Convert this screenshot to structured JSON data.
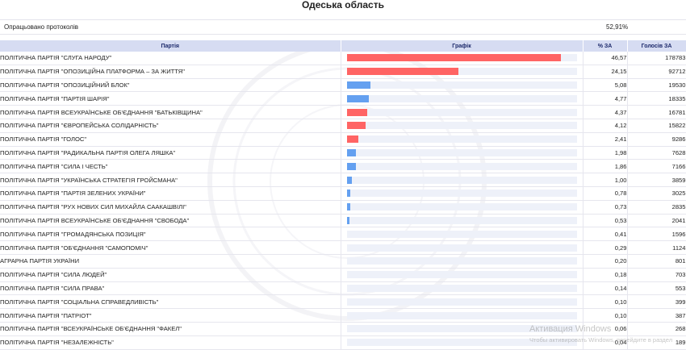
{
  "page": {
    "title": "Одеська область"
  },
  "processed": {
    "label": "Опрацьовано протоколів",
    "value": "52,91%"
  },
  "table": {
    "headers": {
      "party": "Партія",
      "graph": "Графік",
      "percent": "% ЗА",
      "votes": "Голосів ЗА"
    },
    "rows": [
      {
        "party": "ПОЛІТИЧНА ПАРТІЯ \"СЛУГА НАРОДУ\"",
        "percent": "46,57",
        "votes": "178783",
        "share": 46.57,
        "color": "#ff6464"
      },
      {
        "party": "ПОЛІТИЧНА ПАРТІЯ \"ОПОЗИЦІЙНА ПЛАТФОРМА – ЗА ЖИТТЯ\"",
        "percent": "24,15",
        "votes": "92712",
        "share": 24.15,
        "color": "#ff6464"
      },
      {
        "party": "ПОЛІТИЧНА ПАРТІЯ \"ОПОЗИЦІЙНИЙ БЛОК\"",
        "percent": "5,08",
        "votes": "19530",
        "share": 5.08,
        "color": "#64a0f0"
      },
      {
        "party": "ПОЛІТИЧНА ПАРТІЯ \"ПАРТІЯ ШАРІЯ\"",
        "percent": "4,77",
        "votes": "18335",
        "share": 4.77,
        "color": "#64a0f0"
      },
      {
        "party": "ПОЛІТИЧНА ПАРТІЯ ВСЕУКРАЇНСЬКЕ ОБ'ЄДНАННЯ \"БАТЬКІВЩИНА\"",
        "percent": "4,37",
        "votes": "16781",
        "share": 4.37,
        "color": "#ff6464"
      },
      {
        "party": "ПОЛІТИЧНА ПАРТІЯ \"ЄВРОПЕЙСЬКА СОЛІДАРНІСТЬ\"",
        "percent": "4,12",
        "votes": "15822",
        "share": 4.12,
        "color": "#ff6464"
      },
      {
        "party": "ПОЛІТИЧНА ПАРТІЯ \"ГОЛОС\"",
        "percent": "2,41",
        "votes": "9286",
        "share": 2.41,
        "color": "#ff6464"
      },
      {
        "party": "ПОЛІТИЧНА ПАРТІЯ \"РАДИКАЛЬНА ПАРТІЯ ОЛЕГА ЛЯШКА\"",
        "percent": "1,98",
        "votes": "7628",
        "share": 1.98,
        "color": "#64a0f0"
      },
      {
        "party": "ПОЛІТИЧНА ПАРТІЯ \"СИЛА І ЧЕСТЬ\"",
        "percent": "1,86",
        "votes": "7166",
        "share": 1.86,
        "color": "#64a0f0"
      },
      {
        "party": "ПОЛІТИЧНА ПАРТІЯ \"УКРАЇНСЬКА СТРАТЕГІЯ ГРОЙСМАНА\"",
        "percent": "1,00",
        "votes": "3859",
        "share": 1.0,
        "color": "#64a0f0"
      },
      {
        "party": "ПОЛІТИЧНА ПАРТІЯ \"ПАРТІЯ ЗЕЛЕНИХ УКРАЇНИ\"",
        "percent": "0,78",
        "votes": "3025",
        "share": 0.78,
        "color": "#64a0f0"
      },
      {
        "party": "ПОЛІТИЧНА ПАРТІЯ \"РУХ НОВИХ СИЛ МИХАЙЛА СААКАШВІЛІ\"",
        "percent": "0,73",
        "votes": "2835",
        "share": 0.73,
        "color": "#64a0f0"
      },
      {
        "party": "ПОЛІТИЧНА ПАРТІЯ ВСЕУКРАЇНСЬКЕ ОБ'ЄДНАННЯ \"СВОБОДА\"",
        "percent": "0,53",
        "votes": "2041",
        "share": 0.53,
        "color": "#64a0f0"
      },
      {
        "party": "ПОЛІТИЧНА ПАРТІЯ \"ГРОМАДЯНСЬКА ПОЗИЦІЯ\"",
        "percent": "0,41",
        "votes": "1596",
        "share": 0,
        "color": "#64a0f0"
      },
      {
        "party": "ПОЛІТИЧНА ПАРТІЯ \"ОБ'ЄДНАННЯ \"САМОПОМІЧ\"",
        "percent": "0,29",
        "votes": "1124",
        "share": 0,
        "color": "#64a0f0"
      },
      {
        "party": "АГРАРНА ПАРТІЯ УКРАЇНИ",
        "percent": "0,20",
        "votes": "801",
        "share": 0,
        "color": "#64a0f0"
      },
      {
        "party": "ПОЛІТИЧНА ПАРТІЯ \"СИЛА ЛЮДЕЙ\"",
        "percent": "0,18",
        "votes": "703",
        "share": 0,
        "color": "#64a0f0"
      },
      {
        "party": "ПОЛІТИЧНА ПАРТІЯ \"СИЛА ПРАВА\"",
        "percent": "0,14",
        "votes": "553",
        "share": 0,
        "color": "#64a0f0"
      },
      {
        "party": "ПОЛІТИЧНА ПАРТІЯ \"СОЦІАЛЬНА СПРАВЕДЛИВІСТЬ\"",
        "percent": "0,10",
        "votes": "399",
        "share": 0,
        "color": "#64a0f0"
      },
      {
        "party": "ПОЛІТИЧНА ПАРТІЯ \"ПАТРІОТ\"",
        "percent": "0,10",
        "votes": "387",
        "share": 0,
        "color": "#64a0f0"
      },
      {
        "party": "ПОЛІТИЧНА ПАРТІЯ \"ВСЕУКРАЇНСЬКЕ ОБ'ЄДНАННЯ \"ФАКЕЛ\"",
        "percent": "0,06",
        "votes": "268",
        "share": 0,
        "color": "#64a0f0"
      },
      {
        "party": "ПОЛІТИЧНА ПАРТІЯ \"НЕЗАЛЕЖНІСТЬ\"",
        "percent": "0,04",
        "votes": "189",
        "share": 0,
        "color": "#64a0f0"
      }
    ]
  },
  "os_overlay": {
    "title": "Активация Windows",
    "subtitle": "Чтобы активировать Windows, перейдите в раздел"
  }
}
